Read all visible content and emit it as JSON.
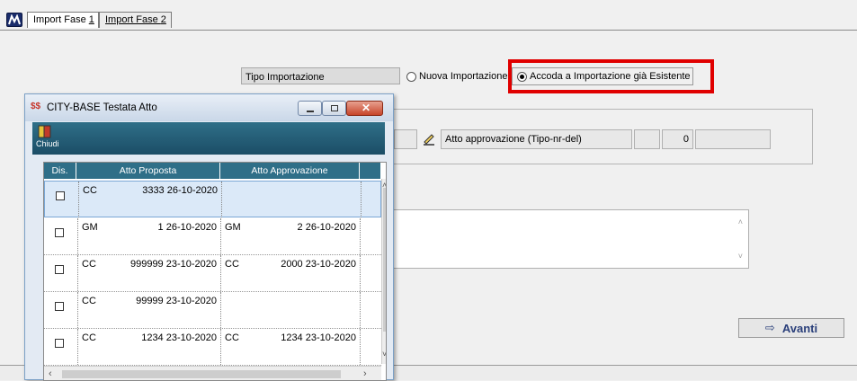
{
  "tabs": [
    {
      "label_pre": "Import Fase ",
      "label_u": "1"
    },
    {
      "label_pre": "Import  Fase ",
      "label_u": "2"
    }
  ],
  "import_type": {
    "label": "Tipo Importazione",
    "options": [
      "Nuova Importazione",
      "Accoda a Importazione già Esistente"
    ],
    "selected": "Accoda a Importazione già Esistente"
  },
  "approval": {
    "label": "Atto approvazione (Tipo-nr-del)",
    "value": "0"
  },
  "next_button": "Avanti",
  "window": {
    "title": "CITY-BASE Testata Atto",
    "close_label": "Chiudi",
    "columns": [
      "Dis.",
      "Atto Proposta",
      "Atto Approvazione"
    ],
    "rows": [
      {
        "p_tipo": "CC",
        "p_num": "3333 26-10-2020",
        "a_tipo": "",
        "a_num": ""
      },
      {
        "p_tipo": "GM",
        "p_num": "1 26-10-2020",
        "a_tipo": "GM",
        "a_num": "2 26-10-2020"
      },
      {
        "p_tipo": "CC",
        "p_num": "999999 23-10-2020",
        "a_tipo": "CC",
        "a_num": "2000 23-10-2020"
      },
      {
        "p_tipo": "CC",
        "p_num": "99999 23-10-2020",
        "a_tipo": "",
        "a_num": ""
      },
      {
        "p_tipo": "CC",
        "p_num": "1234 23-10-2020",
        "a_tipo": "CC",
        "a_num": "1234 23-10-2020"
      }
    ]
  }
}
